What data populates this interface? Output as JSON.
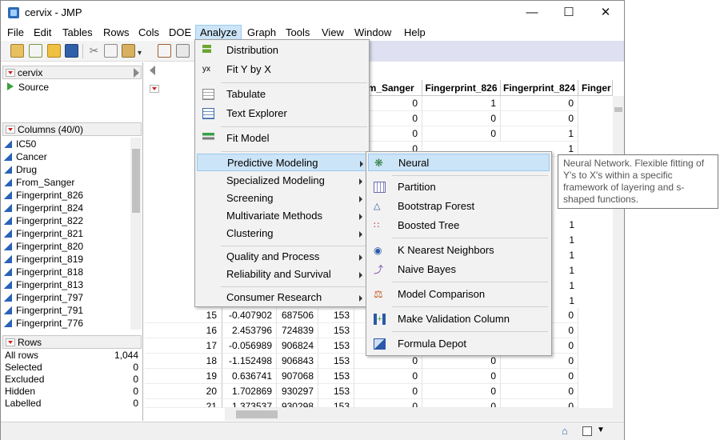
{
  "window": {
    "title": "cervix - JMP"
  },
  "menubar": [
    "File",
    "Edit",
    "Tables",
    "Rows",
    "Cols",
    "DOE",
    "Analyze",
    "Graph",
    "Tools",
    "View",
    "Window",
    "Help"
  ],
  "left_panel": {
    "table_name": "cervix",
    "script": "Source",
    "columns_header": "Columns (40/0)",
    "columns": [
      "IC50",
      "Cancer",
      "Drug",
      "From_Sanger",
      "Fingerprint_826",
      "Fingerprint_824",
      "Fingerprint_822",
      "Fingerprint_821",
      "Fingerprint_820",
      "Fingerprint_819",
      "Fingerprint_818",
      "Fingerprint_813",
      "Fingerprint_797",
      "Fingerprint_791",
      "Fingerprint_776"
    ],
    "rows_header": "Rows",
    "rows_stats": [
      {
        "label": "All rows",
        "value": "1,044"
      },
      {
        "label": "Selected",
        "value": "0"
      },
      {
        "label": "Excluded",
        "value": "0"
      },
      {
        "label": "Hidden",
        "value": "0"
      },
      {
        "label": "Labelled",
        "value": "0"
      }
    ]
  },
  "grid": {
    "headers": [
      "om_Sanger",
      "Fingerprint_826",
      "Fingerprint_824",
      "Finger"
    ],
    "top_rows": [
      [
        "0",
        "1",
        "0"
      ],
      [
        "0",
        "0",
        "0"
      ],
      [
        "0",
        "0",
        "1"
      ],
      [
        "0",
        "",
        "1"
      ]
    ],
    "right_only": [
      "1",
      "1",
      "1",
      "1",
      "1",
      "1"
    ],
    "bottom_rows": [
      {
        "row": "15",
        "c1": "-0.407902",
        "c2": "687506",
        "c3": "153",
        "c4": "0",
        "c5": "0",
        "c6": "0"
      },
      {
        "row": "16",
        "c1": "2.453796",
        "c2": "724839",
        "c3": "153",
        "c4": "0",
        "c5": "0",
        "c6": "0"
      },
      {
        "row": "17",
        "c1": "-0.056989",
        "c2": "906824",
        "c3": "153",
        "c4": "0",
        "c5": "0",
        "c6": "0"
      },
      {
        "row": "18",
        "c1": "-1.152498",
        "c2": "906843",
        "c3": "153",
        "c4": "0",
        "c5": "0",
        "c6": "0"
      },
      {
        "row": "19",
        "c1": "0.636741",
        "c2": "907068",
        "c3": "153",
        "c4": "0",
        "c5": "0",
        "c6": "0"
      },
      {
        "row": "20",
        "c1": "1.702869",
        "c2": "930297",
        "c3": "153",
        "c4": "0",
        "c5": "0",
        "c6": "0"
      },
      {
        "row": "21",
        "c1": "1.373537",
        "c2": "930298",
        "c3": "153",
        "c4": "0",
        "c5": "0",
        "c6": "0"
      }
    ]
  },
  "analyze_menu": {
    "items": [
      "Distribution",
      "Fit Y by X",
      "Tabulate",
      "Text Explorer",
      "Fit Model",
      "Predictive Modeling",
      "Specialized Modeling",
      "Screening",
      "Multivariate Methods",
      "Clustering",
      "Quality and Process",
      "Reliability and Survival",
      "Consumer Research"
    ]
  },
  "predictive_submenu": {
    "items": [
      "Neural",
      "Partition",
      "Bootstrap Forest",
      "Boosted Tree",
      "K Nearest Neighbors",
      "Naive Bayes",
      "Model Comparison",
      "Make Validation Column",
      "Formula Depot"
    ]
  },
  "tooltip": "Neural Network. Flexible fitting of Y's to X's within a specific framework of layering and s-shaped functions.",
  "colors": {
    "accent": "#cce4f7",
    "highlight_border": "#99c9ef",
    "marker_red": "#d32020",
    "column_blue": "#2a62b8"
  }
}
